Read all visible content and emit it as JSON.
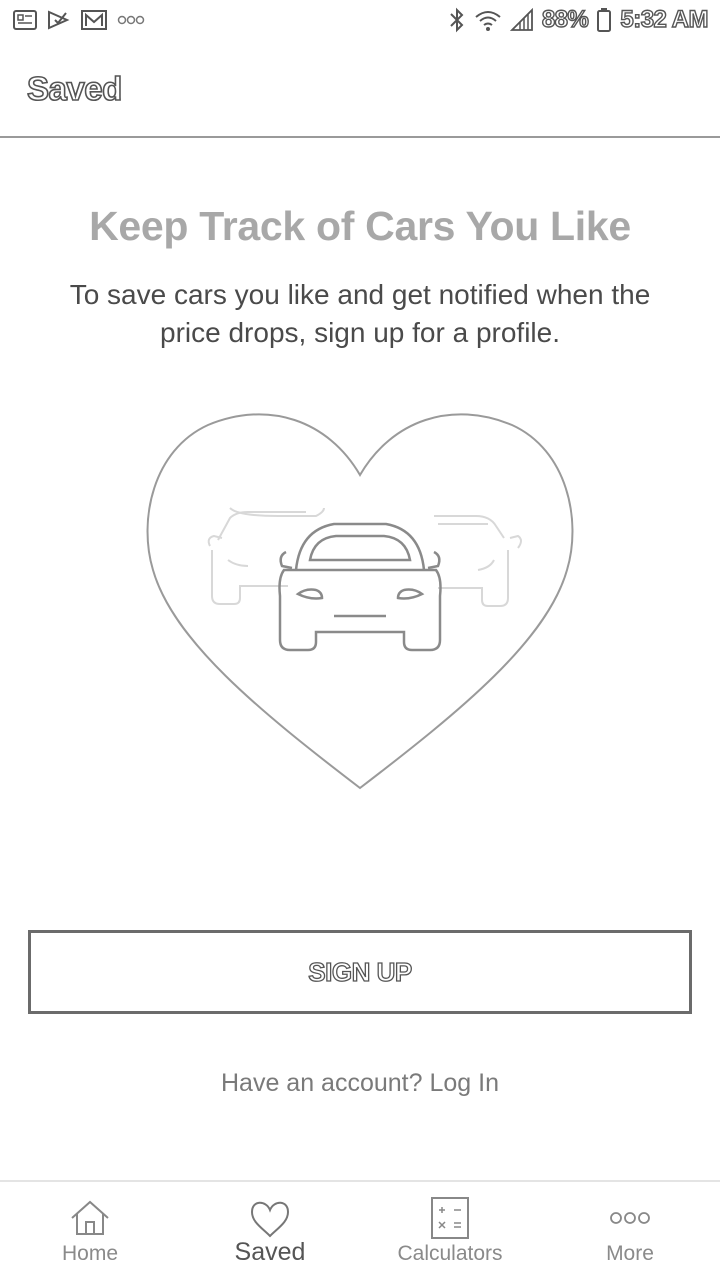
{
  "status_bar": {
    "battery": "88%",
    "time": "5:32 AM",
    "left_icons": [
      "photo-icon",
      "check-icon",
      "gmail-icon",
      "more-dots-icon"
    ],
    "right_icons": [
      "bluetooth-icon",
      "wifi-icon",
      "signal-icon",
      "battery-icon"
    ]
  },
  "app_bar": {
    "title": "Saved"
  },
  "main": {
    "headline": "Keep Track of Cars You Like",
    "description": "To save cars you like and get notified when the price drops, sign up for a profile.",
    "illustration_icons": [
      "heart-icon",
      "car-icon"
    ],
    "signup_label": "SIGN UP",
    "login_text": "Have an account? Log In"
  },
  "bottom_nav": {
    "items": [
      {
        "label": "Home",
        "icon": "home-icon",
        "active": false
      },
      {
        "label": "Saved",
        "icon": "heart-icon",
        "active": true
      },
      {
        "label": "Calculators",
        "icon": "calculator-icon",
        "active": false
      },
      {
        "label": "More",
        "icon": "more-dots-icon",
        "active": false
      }
    ]
  },
  "colors": {
    "background": "#ffffff",
    "text_dark": "#444444",
    "headline": "#a8a8a8",
    "border": "#6b6b6b",
    "illustration_line": "#b5b5b5"
  }
}
